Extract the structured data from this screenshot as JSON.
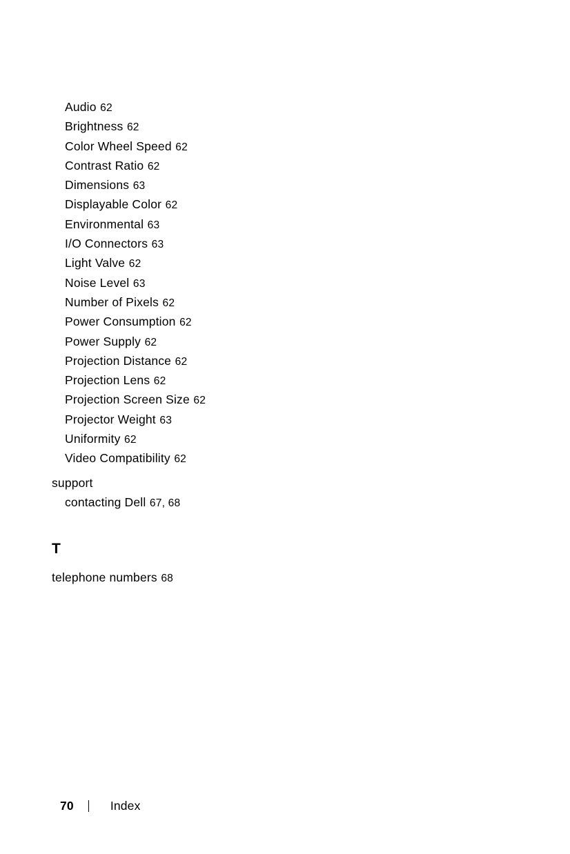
{
  "document": {
    "type": "index-page",
    "page_number": "70",
    "footer_label": "Index",
    "text_color": "#000000",
    "background_color": "#ffffff"
  },
  "index_entries": [
    {
      "term": "Audio",
      "pages": "62",
      "level": 2
    },
    {
      "term": "Brightness",
      "pages": "62",
      "level": 2
    },
    {
      "term": "Color Wheel Speed",
      "pages": "62",
      "level": 2
    },
    {
      "term": "Contrast Ratio",
      "pages": "62",
      "level": 2
    },
    {
      "term": "Dimensions",
      "pages": "63",
      "level": 2
    },
    {
      "term": "Displayable Color",
      "pages": "62",
      "level": 2
    },
    {
      "term": "Environmental",
      "pages": "63",
      "level": 2
    },
    {
      "term": "I/O Connectors",
      "pages": "63",
      "level": 2
    },
    {
      "term": "Light Valve",
      "pages": "62",
      "level": 2
    },
    {
      "term": "Noise Level",
      "pages": "63",
      "level": 2
    },
    {
      "term": "Number of Pixels",
      "pages": "62",
      "level": 2
    },
    {
      "term": "Power Consumption",
      "pages": "62",
      "level": 2
    },
    {
      "term": "Power Supply",
      "pages": "62",
      "level": 2
    },
    {
      "term": "Projection Distance",
      "pages": "62",
      "level": 2
    },
    {
      "term": "Projection Lens",
      "pages": "62",
      "level": 2
    },
    {
      "term": "Projection Screen Size",
      "pages": "62",
      "level": 2
    },
    {
      "term": "Projector Weight",
      "pages": "63",
      "level": 2
    },
    {
      "term": "Uniformity",
      "pages": "62",
      "level": 2
    },
    {
      "term": "Video Compatibility",
      "pages": "62",
      "level": 2
    },
    {
      "term": "support",
      "pages": "",
      "level": 1,
      "gap_before": true
    },
    {
      "term": "contacting Dell",
      "pages": "67, 68",
      "level": 2
    }
  ],
  "sections": [
    {
      "letter": "T",
      "entries": [
        {
          "term": "telephone numbers",
          "pages": "68",
          "level": 1
        }
      ]
    }
  ]
}
